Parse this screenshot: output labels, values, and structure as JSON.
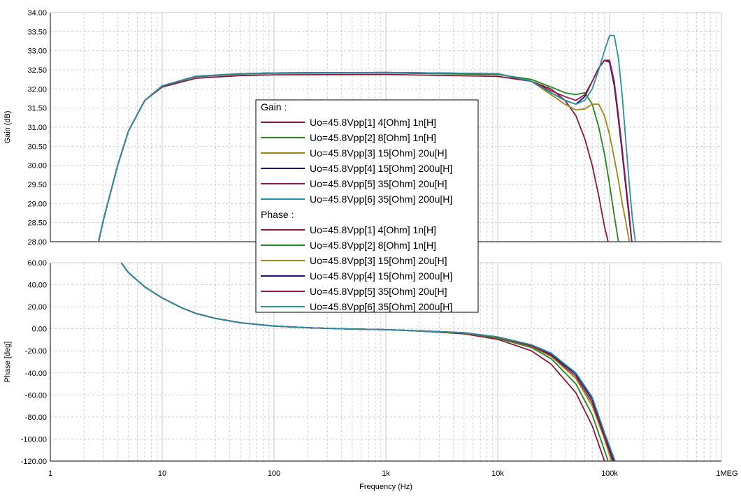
{
  "chart_data": [
    {
      "type": "line",
      "panel": "gain",
      "ylabel": "Gain (dB)",
      "xscale": "log",
      "xlim": [
        1,
        1000000
      ],
      "ylim": [
        28,
        34
      ],
      "yticks": [
        "34.00",
        "33.50",
        "33.00",
        "32.50",
        "32.00",
        "31.50",
        "31.00",
        "30.50",
        "30.00",
        "29.50",
        "29.00",
        "28.50",
        "28.00"
      ],
      "grid": true,
      "legend": {
        "title": "Gain :",
        "placement": "center",
        "entries": [
          "Uo=45.8Vpp[1]  4[Ohm] 1n[H]",
          "Uo=45.8Vpp[2]  8[Ohm] 1n[H]",
          "Uo=45.8Vpp[3]  15[Ohm] 20u[H]",
          "Uo=45.8Vpp[4]  15[Ohm] 200u[H]",
          "Uo=45.8Vpp[5]  35[Ohm] 20u[H]",
          "Uo=45.8Vpp[6]  35[Ohm] 200u[H]"
        ]
      },
      "series": [
        {
          "name": "Uo=45.8Vpp[1]  4[Ohm] 1n[H]",
          "color": "#8b1538",
          "x": [
            2.7,
            3,
            4,
            5,
            7,
            10,
            20,
            50,
            100,
            1000,
            10000,
            20000,
            30000,
            40000,
            50000,
            60000,
            70000,
            80000,
            90000,
            97000
          ],
          "y": [
            28.0,
            28.6,
            30.0,
            30.9,
            31.7,
            32.05,
            32.28,
            32.35,
            32.37,
            32.38,
            32.33,
            32.2,
            32.0,
            31.7,
            31.3,
            30.7,
            30.0,
            29.2,
            28.4,
            28.0
          ]
        },
        {
          "name": "Uo=45.8Vpp[2]  8[Ohm] 1n[H]",
          "color": "#1e8a1e",
          "x": [
            2.7,
            3,
            4,
            5,
            7,
            10,
            20,
            50,
            100,
            1000,
            10000,
            20000,
            30000,
            40000,
            50000,
            60000,
            70000,
            80000,
            90000,
            100000,
            110000,
            120000
          ],
          "y": [
            28.0,
            28.6,
            30.0,
            30.9,
            31.7,
            32.08,
            32.32,
            32.39,
            32.41,
            32.42,
            32.38,
            32.25,
            32.05,
            31.9,
            31.85,
            31.9,
            31.6,
            31.0,
            30.3,
            29.5,
            28.7,
            28.0
          ]
        },
        {
          "name": "Uo=45.8Vpp[3]  15[Ohm] 20u[H]",
          "color": "#9a8a14",
          "x": [
            2.7,
            3,
            4,
            5,
            7,
            10,
            20,
            50,
            100,
            1000,
            10000,
            20000,
            30000,
            40000,
            50000,
            60000,
            70000,
            80000,
            90000,
            100000,
            110000,
            120000,
            130000,
            140000,
            150000
          ],
          "y": [
            28.0,
            28.6,
            30.0,
            30.9,
            31.7,
            32.08,
            32.33,
            32.4,
            32.42,
            32.43,
            32.4,
            32.2,
            31.85,
            31.6,
            31.45,
            31.48,
            31.6,
            31.6,
            31.3,
            30.8,
            30.2,
            29.6,
            29.0,
            28.5,
            28.0
          ]
        },
        {
          "name": "Uo=45.8Vpp[4]  15[Ohm] 200u[H]",
          "color": "#14146e",
          "x": [
            2.7,
            3,
            4,
            5,
            7,
            10,
            20,
            50,
            100,
            1000,
            10000,
            20000,
            30000,
            40000,
            50000,
            60000,
            70000,
            80000,
            90000,
            100000,
            110000,
            120000,
            130000,
            140000,
            150000,
            158000
          ],
          "y": [
            28.0,
            28.6,
            30.0,
            30.9,
            31.7,
            32.08,
            32.33,
            32.4,
            32.42,
            32.43,
            32.4,
            32.2,
            31.9,
            31.7,
            31.6,
            31.8,
            32.2,
            32.55,
            32.75,
            32.7,
            32.1,
            31.2,
            30.3,
            29.4,
            28.6,
            28.0
          ]
        },
        {
          "name": "Uo=45.8Vpp[5]  35[Ohm] 20u[H]",
          "color": "#9a1450",
          "x": [
            2.7,
            3,
            4,
            5,
            7,
            10,
            20,
            50,
            100,
            1000,
            10000,
            20000,
            30000,
            40000,
            50000,
            60000,
            70000,
            80000,
            90000,
            100000,
            110000,
            120000,
            130000,
            140000,
            150000,
            158000
          ],
          "y": [
            28.0,
            28.6,
            30.0,
            30.9,
            31.7,
            32.08,
            32.33,
            32.4,
            32.42,
            32.43,
            32.4,
            32.2,
            31.95,
            31.8,
            31.7,
            31.85,
            32.2,
            32.55,
            32.75,
            32.75,
            32.2,
            31.3,
            30.4,
            29.5,
            28.7,
            28.0
          ]
        },
        {
          "name": "Uo=45.8Vpp[6]  35[Ohm] 200u[H]",
          "color": "#2a8fa0",
          "x": [
            2.7,
            3,
            4,
            5,
            7,
            10,
            20,
            50,
            100,
            1000,
            10000,
            20000,
            30000,
            40000,
            50000,
            60000,
            70000,
            80000,
            90000,
            100000,
            110000,
            120000,
            130000,
            140000,
            150000,
            160000,
            170000
          ],
          "y": [
            28.0,
            28.6,
            30.0,
            30.9,
            31.7,
            32.08,
            32.33,
            32.4,
            32.42,
            32.43,
            32.4,
            32.2,
            31.9,
            31.7,
            31.6,
            31.7,
            32.0,
            32.5,
            33.0,
            33.4,
            33.4,
            32.8,
            31.8,
            30.6,
            29.5,
            28.6,
            28.0
          ]
        }
      ]
    },
    {
      "type": "line",
      "panel": "phase",
      "ylabel": "Phase [deg]",
      "xlabel": "Frequency (Hz)",
      "xscale": "log",
      "xlim": [
        1,
        1000000
      ],
      "ylim": [
        -120,
        60
      ],
      "yticks": [
        "60.00",
        "40.00",
        "20.00",
        "0.00",
        "-20.00",
        "-40.00",
        "-60.00",
        "-80.00",
        "-100.00",
        "-120.00"
      ],
      "xticks": [
        {
          "value": 1,
          "label": "1"
        },
        {
          "value": 10,
          "label": "10"
        },
        {
          "value": 100,
          "label": "100"
        },
        {
          "value": 1000,
          "label": "1k"
        },
        {
          "value": 10000,
          "label": "10k"
        },
        {
          "value": 100000,
          "label": "100k"
        },
        {
          "value": 1000000,
          "label": "1MEG"
        }
      ],
      "grid": true,
      "legend": {
        "title": "Phase :",
        "placement": "center",
        "entries": [
          "Uo=45.8Vpp[1]  4[Ohm] 1n[H]",
          "Uo=45.8Vpp[2]  8[Ohm] 1n[H]",
          "Uo=45.8Vpp[3]  15[Ohm] 20u[H]",
          "Uo=45.8Vpp[4]  15[Ohm] 200u[H]",
          "Uo=45.8Vpp[5]  35[Ohm] 20u[H]",
          "Uo=45.8Vpp[6]  35[Ohm] 200u[H]"
        ]
      },
      "series": [
        {
          "name": "Uo=45.8Vpp[1]  4[Ohm] 1n[H]",
          "color": "#8b1538",
          "x": [
            4.3,
            5,
            7,
            10,
            15,
            20,
            30,
            50,
            100,
            200,
            500,
            1000,
            2000,
            5000,
            10000,
            20000,
            30000,
            50000,
            70000,
            90000
          ],
          "y": [
            60,
            51,
            38,
            28,
            19,
            14,
            9.5,
            5.5,
            2.5,
            1.0,
            -0.2,
            -0.8,
            -2.0,
            -4.5,
            -9.5,
            -20,
            -32,
            -58,
            -88,
            -120
          ]
        },
        {
          "name": "Uo=45.8Vpp[2]  8[Ohm] 1n[H]",
          "color": "#1e8a1e",
          "x": [
            4.3,
            5,
            7,
            10,
            15,
            20,
            30,
            50,
            100,
            200,
            500,
            1000,
            2000,
            5000,
            10000,
            20000,
            30000,
            50000,
            70000,
            97000
          ],
          "y": [
            60,
            51,
            38,
            28,
            19,
            14,
            9.5,
            5.5,
            2.5,
            1.0,
            -0.2,
            -0.8,
            -2.0,
            -4.0,
            -8.5,
            -17,
            -27,
            -50,
            -78,
            -120
          ]
        },
        {
          "name": "Uo=45.8Vpp[3]  15[Ohm] 20u[H]",
          "color": "#9a8a14",
          "x": [
            4.3,
            5,
            7,
            10,
            15,
            20,
            30,
            50,
            100,
            200,
            500,
            1000,
            2000,
            5000,
            10000,
            20000,
            30000,
            50000,
            70000,
            90000,
            104000
          ],
          "y": [
            60,
            51,
            38,
            28,
            19,
            14,
            9.5,
            5.5,
            2.5,
            1.0,
            -0.2,
            -0.8,
            -1.9,
            -3.8,
            -8.0,
            -16,
            -25,
            -45,
            -70,
            -100,
            -120
          ]
        },
        {
          "name": "Uo=45.8Vpp[4]  15[Ohm] 200u[H]",
          "color": "#14146e",
          "x": [
            4.3,
            5,
            7,
            10,
            15,
            20,
            30,
            50,
            100,
            200,
            500,
            1000,
            2000,
            5000,
            10000,
            20000,
            30000,
            50000,
            70000,
            90000,
            110000
          ],
          "y": [
            60,
            51,
            38,
            28,
            19,
            14,
            9.5,
            5.5,
            2.5,
            1.0,
            -0.2,
            -0.8,
            -1.8,
            -3.6,
            -7.5,
            -15,
            -23,
            -41,
            -64,
            -96,
            -120
          ]
        },
        {
          "name": "Uo=45.8Vpp[5]  35[Ohm] 20u[H]",
          "color": "#9a1450",
          "x": [
            4.3,
            5,
            7,
            10,
            15,
            20,
            30,
            50,
            100,
            200,
            500,
            1000,
            2000,
            5000,
            10000,
            20000,
            30000,
            50000,
            70000,
            90000,
            107000
          ],
          "y": [
            60,
            51,
            38,
            28,
            19,
            14,
            9.5,
            5.5,
            2.5,
            1.0,
            -0.2,
            -0.8,
            -1.8,
            -3.7,
            -7.7,
            -15.5,
            -24,
            -43,
            -67,
            -98,
            -120
          ]
        },
        {
          "name": "Uo=45.8Vpp[6]  35[Ohm] 200u[H]",
          "color": "#2a8fa0",
          "x": [
            4.3,
            5,
            7,
            10,
            15,
            20,
            30,
            50,
            100,
            200,
            500,
            1000,
            2000,
            5000,
            10000,
            20000,
            30000,
            50000,
            70000,
            90000,
            112000
          ],
          "y": [
            60,
            51,
            38,
            28,
            19,
            14,
            9.5,
            5.5,
            2.5,
            1.0,
            -0.2,
            -0.8,
            -1.8,
            -3.5,
            -7.3,
            -14.5,
            -22,
            -40,
            -62,
            -94,
            -120
          ]
        }
      ]
    }
  ]
}
